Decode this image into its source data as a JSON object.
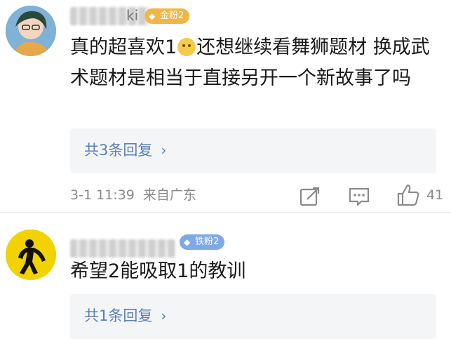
{
  "comments": [
    {
      "username_tail": "ki",
      "badge": "金粉2",
      "text_before_emoji": "真的超喜欢1",
      "emoji_icon": "crying-face-icon",
      "text_after_emoji": "还想继续看舞狮题材 换成武术题材是相当于直接另开一个新故事了吗",
      "reply_link": "共3条回复",
      "timestamp": "3-1 11:39",
      "location": "来自广东",
      "like_count": "41"
    },
    {
      "badge": "铁粉2",
      "text": "希望2能吸取1的教训",
      "reply_link": "共1条回复"
    }
  ],
  "colors": {
    "gold_badge": "#f3b545",
    "iron_badge": "#7fa9e6",
    "link": "#5b7fb6",
    "reply_bg": "#f4f5f7"
  }
}
